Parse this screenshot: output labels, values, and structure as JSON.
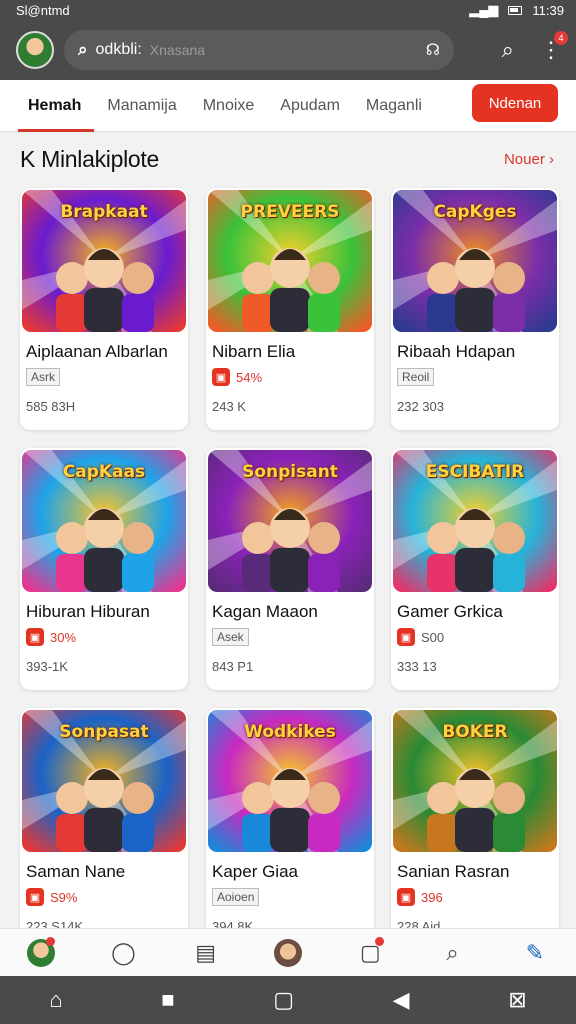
{
  "status": {
    "left": "Sl@ntmd",
    "time": "11:39"
  },
  "search": {
    "query": "odkbli:",
    "placeholder": "Xnasana"
  },
  "tabs": [
    "Hemah",
    "Manamija",
    "Mnoixe",
    "Apudam",
    "Maganli"
  ],
  "tab_cta": "Ndenan",
  "section": {
    "title": "K Minlakiplote",
    "more": "Nouer"
  },
  "cards": [
    {
      "title": "Aiplaanan Albarlan",
      "tag": "Asrk",
      "meta": "585 83H",
      "banner": "Brapkaat",
      "colors": [
        "#6a1bd0",
        "#f7b21b",
        "#e53935"
      ]
    },
    {
      "title": "Nibarn Elia",
      "tag": "54%",
      "meta": "243 K",
      "banner": "PREVEERS",
      "colors": [
        "#3ac23a",
        "#f2d12b",
        "#f05a28"
      ]
    },
    {
      "title": "Ribaah Hdapan",
      "tag": "Reoil",
      "meta": "232 303",
      "banner": "CapKges",
      "colors": [
        "#7b2ea8",
        "#f08a24",
        "#2b3a8f"
      ]
    },
    {
      "title": "Hiburan Hiburan",
      "tag": "30%",
      "meta": "393-1K",
      "banner": "CapKaas",
      "colors": [
        "#1ea3e8",
        "#f8c52a",
        "#e8368f"
      ]
    },
    {
      "title": "Kagan Maaon",
      "tag": "Asek",
      "meta": "843 P1",
      "banner": "Sonpisant",
      "colors": [
        "#8a22b8",
        "#f6a21e",
        "#5a2a7a"
      ]
    },
    {
      "title": "Gamer Grkica",
      "tag": "S00",
      "meta": "333 13",
      "banner": "ESCIBATIR",
      "colors": [
        "#26b3d9",
        "#f2d12b",
        "#e6336a"
      ]
    },
    {
      "title": "Saman Nane",
      "tag": "S9%",
      "meta": "223 S14K",
      "banner": "Sonpasat",
      "colors": [
        "#1a63c7",
        "#f4b21f",
        "#e53935"
      ]
    },
    {
      "title": "Kaper Giaa",
      "tag": "Aoioen",
      "meta": "394 8K",
      "banner": "Wodkikes",
      "colors": [
        "#c72ac0",
        "#f6c72a",
        "#1a88d8"
      ]
    },
    {
      "title": "Sanian Rasran",
      "tag": "396",
      "meta": "228 Aid",
      "banner": "BOKER",
      "colors": [
        "#2a8a35",
        "#f2c22a",
        "#c7781e"
      ]
    }
  ]
}
